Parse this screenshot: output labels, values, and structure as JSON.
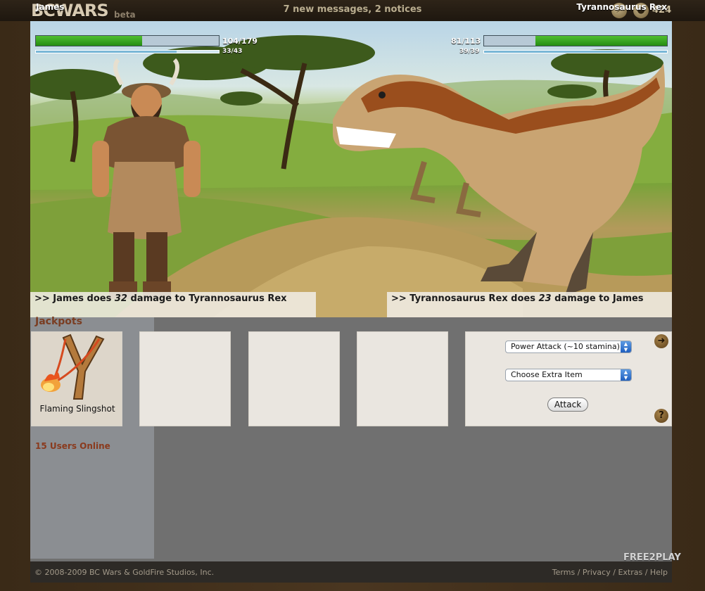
{
  "header": {
    "logo_text": "BCWARS",
    "logo_badge": "beta",
    "notifications": "7 new messages, 2 notices",
    "coins": "424",
    "energy_icon": "lightning-icon",
    "coin_icon": "coin-icon"
  },
  "battle": {
    "player": {
      "name": "James",
      "hp_text": "104/179",
      "hp_fraction": 0.58,
      "stamina_text": "33/43",
      "stamina_fraction": 0.77
    },
    "enemy": {
      "name": "Tyrannosaurus Rex",
      "hp_text": "81/113",
      "hp_fraction": 0.72,
      "stamina_text": "39/39",
      "stamina_fraction": 1.0
    },
    "log": {
      "left_prefix": ">> James does ",
      "left_damage": "32",
      "left_suffix": " damage to Tyrannosaurus Rex",
      "right_prefix": ">> Tyrannosaurus Rex does ",
      "right_damage": "23",
      "right_suffix": " damage to James"
    }
  },
  "jackpots": {
    "title": "Jackpots",
    "slots": [
      {
        "label": "Flaming Slingshot",
        "icon": "slingshot-icon"
      },
      {
        "label": ""
      },
      {
        "label": ""
      },
      {
        "label": ""
      }
    ]
  },
  "sidebar": {
    "users_online": "15 Users Online"
  },
  "actions": {
    "attack_type": "Power Attack (~10 stamina)",
    "extra_item": "Choose Extra Item",
    "attack_label": "Attack"
  },
  "footer": {
    "copyright": "© 2008-2009 BC Wars & GoldFire Studios, Inc.",
    "links": [
      "Terms",
      "Privacy",
      "Extras",
      "Help"
    ],
    "separator": " / "
  },
  "watermark": "FREE2PLAY"
}
